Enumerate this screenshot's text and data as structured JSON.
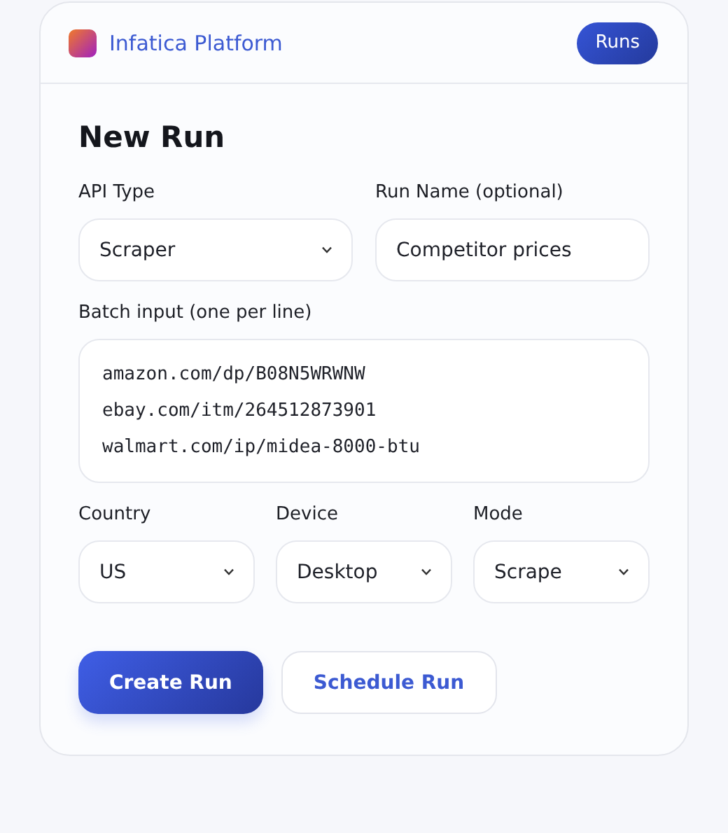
{
  "header": {
    "brand": "Infatica Platform",
    "nav_button": "Runs"
  },
  "title": "New Run",
  "rows": [
    [
      {
        "kind": "select",
        "label": "API Type",
        "value": "Scraper"
      },
      {
        "kind": "text",
        "label": "Run Name (optional)",
        "value": "Competitor prices"
      }
    ],
    [
      {
        "kind": "textarea",
        "label": "Batch input (one per line)",
        "lines": [
          "amazon.com/dp/B08N5WRWNW",
          "ebay.com/itm/264512873901",
          "walmart.com/ip/midea-8000-btu"
        ]
      }
    ],
    [
      {
        "kind": "select",
        "label": "Country",
        "value": "US"
      },
      {
        "kind": "select",
        "label": "Device",
        "value": "Desktop"
      },
      {
        "kind": "select",
        "label": "Mode",
        "value": "Scrape"
      }
    ]
  ],
  "buttons": [
    {
      "kind": "primary",
      "label": "Create Run"
    },
    {
      "kind": "secondary",
      "label": "Schedule Run"
    }
  ]
}
